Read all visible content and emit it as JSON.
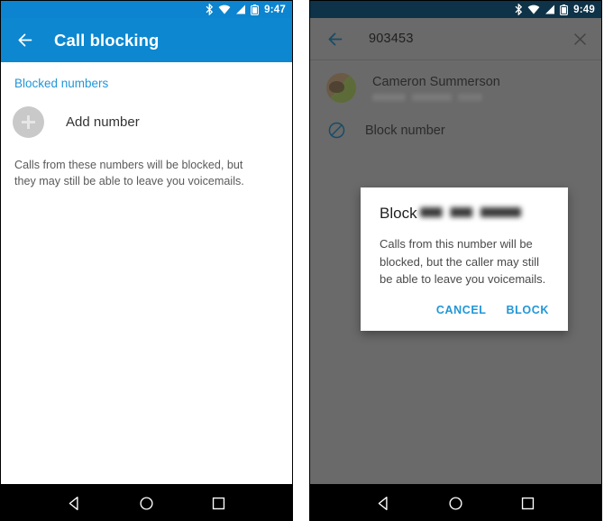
{
  "left_screen": {
    "status_bar": {
      "time": "9:47",
      "icons": [
        "bluetooth-icon",
        "wifi-icon",
        "signal-icon",
        "battery-icon"
      ]
    },
    "app_bar": {
      "back_icon": "back-arrow-icon",
      "title": "Call blocking"
    },
    "content": {
      "section_title": "Blocked numbers",
      "add_number_label": "Add number",
      "add_number_icon": "plus-icon",
      "description": "Calls from these numbers will be blocked, but they may still be able to leave you voicemails."
    },
    "nav_bar": {
      "back": "back-triangle-icon",
      "home": "home-circle-icon",
      "recents": "recents-square-icon"
    }
  },
  "right_screen": {
    "status_bar": {
      "time": "9:49",
      "icons": [
        "bluetooth-icon",
        "wifi-icon",
        "signal-icon",
        "battery-icon"
      ]
    },
    "search_bar": {
      "back_icon": "back-arrow-icon",
      "query": "903453",
      "clear_icon": "close-x-icon"
    },
    "results": {
      "contact_name": "Cameron Summerson",
      "contact_subtitle_redacted": "",
      "avatar": "contact-avatar",
      "block_number_label": "Block number",
      "block_number_icon": "block-circle-icon"
    },
    "dialog": {
      "title_prefix": "Block",
      "title_number_redacted": "",
      "message": "Calls from this number will be blocked, but the caller may still be able to leave you voicemails.",
      "cancel_label": "CANCEL",
      "confirm_label": "BLOCK"
    },
    "nav_bar": {
      "back": "back-triangle-icon",
      "home": "home-circle-icon",
      "recents": "recents-square-icon"
    }
  },
  "colors": {
    "app_bar_blue": "#0c87d0",
    "status_bar_blue": "#0c84cf",
    "status_bar_dark": "#0e3247",
    "accent_link": "#2196d8",
    "scrim_gray": "#6a6a6a",
    "nav_bar_black": "#000000"
  }
}
